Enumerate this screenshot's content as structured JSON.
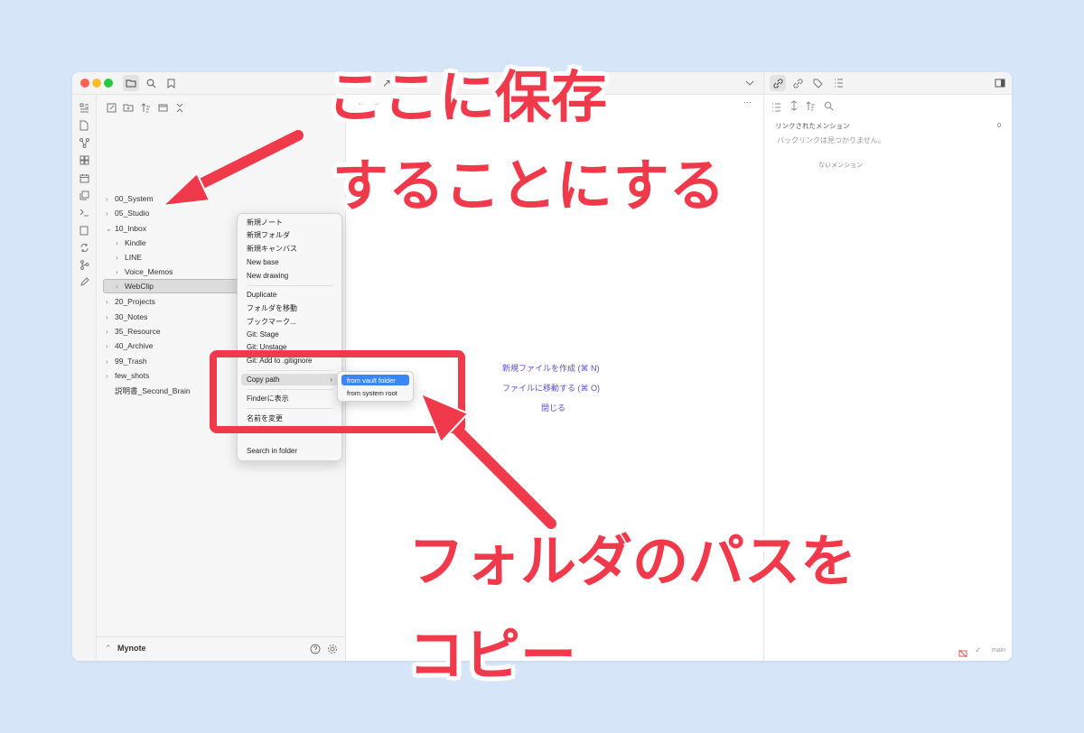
{
  "window": {
    "tab_title_fragment": "↗",
    "editor_more": "···",
    "nav_back": "←",
    "nav_forward": "→"
  },
  "file_tree": [
    {
      "label": "00_System",
      "chev": "›"
    },
    {
      "label": "05_Studio",
      "chev": "›"
    },
    {
      "label": "10_Inbox",
      "chev": "⌄"
    },
    {
      "label": "Kindle",
      "chev": "›"
    },
    {
      "label": "LINE",
      "chev": "›"
    },
    {
      "label": "Voice_Memos",
      "chev": "›"
    },
    {
      "label": "WebClip",
      "chev": "›"
    },
    {
      "label": "20_Projects",
      "chev": "›"
    },
    {
      "label": "30_Notes",
      "chev": "›"
    },
    {
      "label": "35_Resource",
      "chev": "›"
    },
    {
      "label": "40_Archive",
      "chev": "›"
    },
    {
      "label": "99_Trash",
      "chev": "›"
    },
    {
      "label": "few_shots",
      "chev": "›"
    },
    {
      "label": "説明書_Second_Brain",
      "chev": ""
    }
  ],
  "vault": {
    "name": "Mynote"
  },
  "context_menu": {
    "items": [
      "新規ノート",
      "新規フォルダ",
      "新規キャンバス",
      "New base",
      "New drawing",
      "Duplicate",
      "フォルダを移動",
      "ブックマーク...",
      "Git: Stage",
      "Git: Unstage",
      "Git: Add to .gitignore",
      "Copy path",
      "Finderに表示",
      "名前を変更",
      "Search in folder"
    ],
    "submenu_arrow": "›",
    "submenu": [
      "from vault folder",
      "from system root"
    ]
  },
  "editor_empty": {
    "new_file": "新規ファイルを作成 (⌘ N)",
    "goto_file": "ファイルに移動する (⌘ O)",
    "close": "閉じる"
  },
  "right_panel": {
    "linked_mentions": "リンクされたメンション",
    "linked_count": "0",
    "no_backlinks": "バックリンクは見つかりません。",
    "unlinked_mentions": "ないメンション",
    "branch": "main"
  },
  "callouts": {
    "top_line1": "ここに保存",
    "top_line2": "することにする",
    "bottom_line1": "フォルダのパスを",
    "bottom_line2": "コピー"
  },
  "colors": {
    "accent_red": "#f0394a",
    "link_purple": "#5b4fc7",
    "selection_blue": "#3b86f7",
    "background": "#d6e6f8"
  }
}
